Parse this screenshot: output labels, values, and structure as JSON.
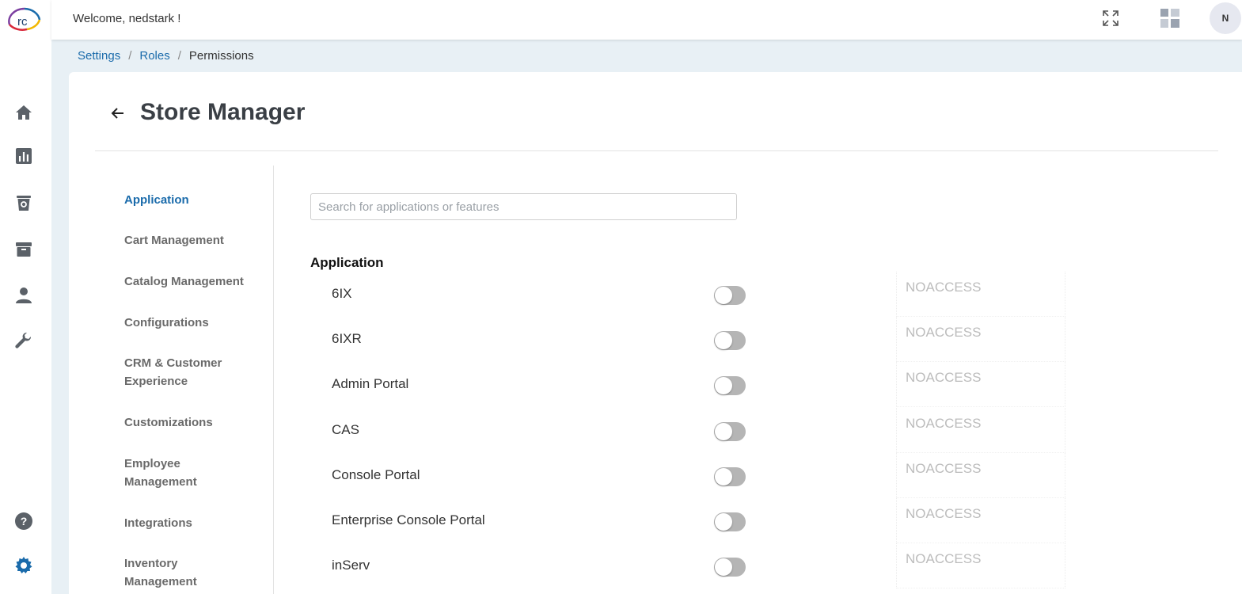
{
  "header": {
    "welcome": "Welcome, nedstark !",
    "avatar_initial": "N",
    "logo_text": "rc"
  },
  "breadcrumb": {
    "items": [
      "Settings",
      "Roles"
    ],
    "separator": "/",
    "current": "Permissions"
  },
  "page": {
    "title": "Store Manager"
  },
  "side_menu": {
    "items": [
      {
        "label": "Application",
        "active": true
      },
      {
        "label": "Cart Management"
      },
      {
        "label": "Catalog Management"
      },
      {
        "label": "Configurations"
      },
      {
        "label": "CRM & Customer Experience"
      },
      {
        "label": "Customizations"
      },
      {
        "label": "Employee Management"
      },
      {
        "label": "Integrations"
      },
      {
        "label": "Inventory Management"
      }
    ]
  },
  "search": {
    "placeholder": "Search for applications or features",
    "value": ""
  },
  "section": {
    "heading": "Application",
    "rows": [
      {
        "label": "6IX",
        "enabled": false,
        "access": "NOACCESS"
      },
      {
        "label": "6IXR",
        "enabled": false,
        "access": "NOACCESS"
      },
      {
        "label": "Admin Portal",
        "enabled": false,
        "access": "NOACCESS"
      },
      {
        "label": "CAS",
        "enabled": false,
        "access": "NOACCESS"
      },
      {
        "label": "Console Portal",
        "enabled": false,
        "access": "NOACCESS"
      },
      {
        "label": "Enterprise Console Portal",
        "enabled": false,
        "access": "NOACCESS"
      },
      {
        "label": "inServ",
        "enabled": false,
        "access": "NOACCESS"
      }
    ]
  },
  "nav_icons": [
    "home-icon",
    "reports-icon",
    "orders-icon",
    "archive-icon",
    "user-icon",
    "tools-icon",
    "help-icon",
    "settings-icon"
  ],
  "colors": {
    "accent": "#1a6bab",
    "settings_active": "#1a6bab",
    "toggle_off": "#b5b5b5",
    "access_text": "#bcbcbc"
  }
}
